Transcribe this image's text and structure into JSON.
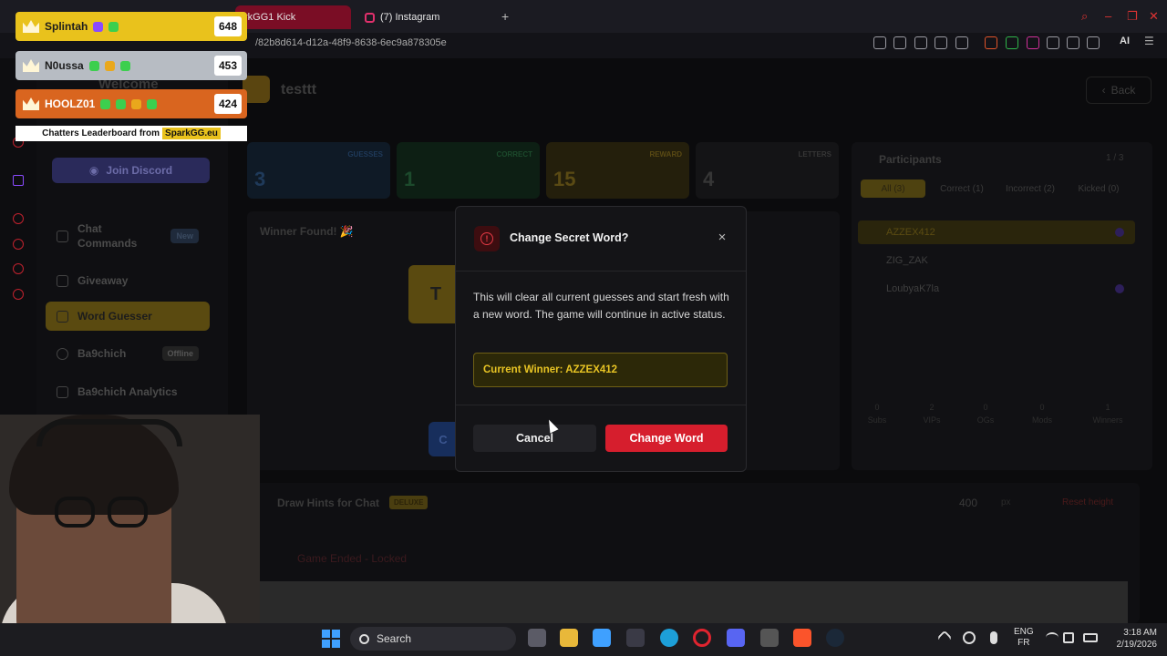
{
  "browser": {
    "tabs": [
      {
        "label": "rkGG1 Kick"
      },
      {
        "label": "(7) Instagram"
      }
    ],
    "new_tab": "+",
    "url": "/82b8d614-d12a-48f9-8638-6ec9a878305e",
    "ai_label": "AI"
  },
  "leaderboard": {
    "rows": [
      {
        "name": "Splintah",
        "score": "648"
      },
      {
        "name": "N0ussa",
        "score": "453"
      },
      {
        "name": "HOOLZ01",
        "score": "424"
      }
    ],
    "footer_text": "Chatters Leaderboard from",
    "footer_brand": "SparkGG.eu"
  },
  "sidebar": {
    "welcome": "Welcome",
    "discord_button": "Join Discord",
    "items": [
      {
        "label": "Chat Commands",
        "badge": "New"
      },
      {
        "label": "Giveaway"
      },
      {
        "label": "Word Guesser"
      },
      {
        "label": "Ba9chich",
        "badge": "Offline"
      },
      {
        "label": "Ba9chich Analytics"
      }
    ]
  },
  "game": {
    "title": "testtt",
    "back_label": "Back",
    "stats": [
      {
        "label": "GUESSES",
        "value": "3"
      },
      {
        "label": "CORRECT",
        "value": "1"
      },
      {
        "label": "REWARD",
        "value": "15"
      },
      {
        "label": "LETTERS",
        "value": "4"
      }
    ],
    "winner_found": "Winner Found! 🎉",
    "letter_tile": "T",
    "blue_button_char": "C"
  },
  "participants": {
    "title": "Participants",
    "count": "1 / 3",
    "tabs": [
      "All (3)",
      "Correct (1)",
      "Incorrect (2)",
      "Kicked (0)"
    ],
    "rows": [
      "AZZEX412",
      "ZIG_ZAK",
      "LoubyaK7la"
    ],
    "stats": [
      {
        "value": "0",
        "label": "Subs"
      },
      {
        "value": "2",
        "label": "VIPs"
      },
      {
        "value": "0",
        "label": "OGs"
      },
      {
        "value": "0",
        "label": "Mods"
      },
      {
        "value": "1",
        "label": "Winners"
      }
    ]
  },
  "hints": {
    "title": "Draw Hints for Chat",
    "badge": "DELUXE",
    "px_value": "400",
    "px_unit": "px",
    "reset_label": "Reset height",
    "locked_label": "Game Ended - Locked"
  },
  "modal": {
    "title": "Change Secret Word?",
    "close": "×",
    "body": "This will clear all current guesses and start fresh with a new word. The game will continue in active status.",
    "winner": "Current Winner: AZZEX412",
    "cancel_label": "Cancel",
    "confirm_label": "Change Word"
  },
  "taskbar": {
    "search_label": "Search",
    "lang_1": "ENG",
    "lang_2": "FR",
    "time": "3:18 AM",
    "date": "2/19/2026"
  },
  "colors": {
    "accent_red": "#d61e2d",
    "winner_gold": "#e8c424",
    "gold": "#e9c21c"
  }
}
